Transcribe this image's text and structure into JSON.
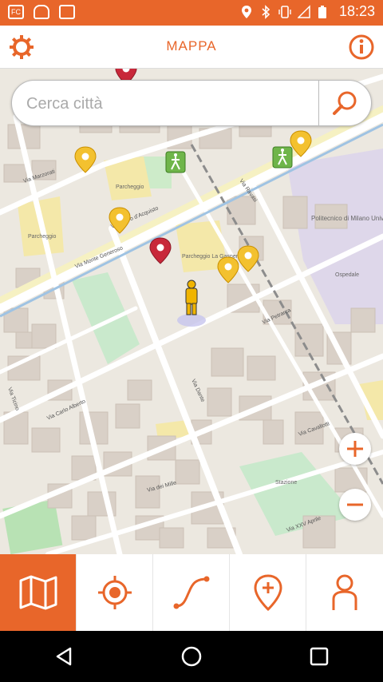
{
  "status_bar": {
    "left_icons": [
      "FC",
      "android-icon",
      "clipboard-check-icon"
    ],
    "right_icons": [
      "location-pin-icon",
      "bluetooth-icon",
      "vibrate-icon",
      "no-signal-icon",
      "battery-icon"
    ],
    "time": "18:23",
    "background": "#e8662a"
  },
  "app_bar": {
    "title": "MAPPA",
    "left_icon": "gear-icon",
    "right_icon": "info-icon",
    "accent": "#e8662a"
  },
  "search": {
    "placeholder": "Cerca città",
    "value": "",
    "button_icon": "search-icon"
  },
  "map": {
    "street_labels": [
      "Via Marzorati",
      "Via Salvo d'Acquisto",
      "Via Carlo Alberto",
      "Via dei Mille",
      "Via Monte Generoso",
      "Via Dante",
      "Via Petrarca",
      "Via Cavallotti",
      "Via Ravasi",
      "Via Ticino",
      "Via XXV Aprile"
    ],
    "poi_labels": [
      "Parcheggio",
      "Politecnico di Milano Università dell'Insubria",
      "Parcheggio La Gaspera",
      "Parcheggio",
      "Ospedale",
      "Stazione"
    ],
    "zoom_in_icon": "plus-icon",
    "zoom_out_icon": "minus-icon",
    "user_marker_icon": "pegman-icon"
  },
  "toolbar": {
    "items": [
      {
        "name": "map-icon",
        "active": true
      },
      {
        "name": "locate-icon",
        "active": false
      },
      {
        "name": "route-icon",
        "active": false
      },
      {
        "name": "add-place-icon",
        "active": false
      },
      {
        "name": "profile-icon",
        "active": false
      }
    ]
  },
  "nav_bar": {
    "items": [
      "back-icon",
      "home-icon",
      "recents-icon"
    ]
  }
}
